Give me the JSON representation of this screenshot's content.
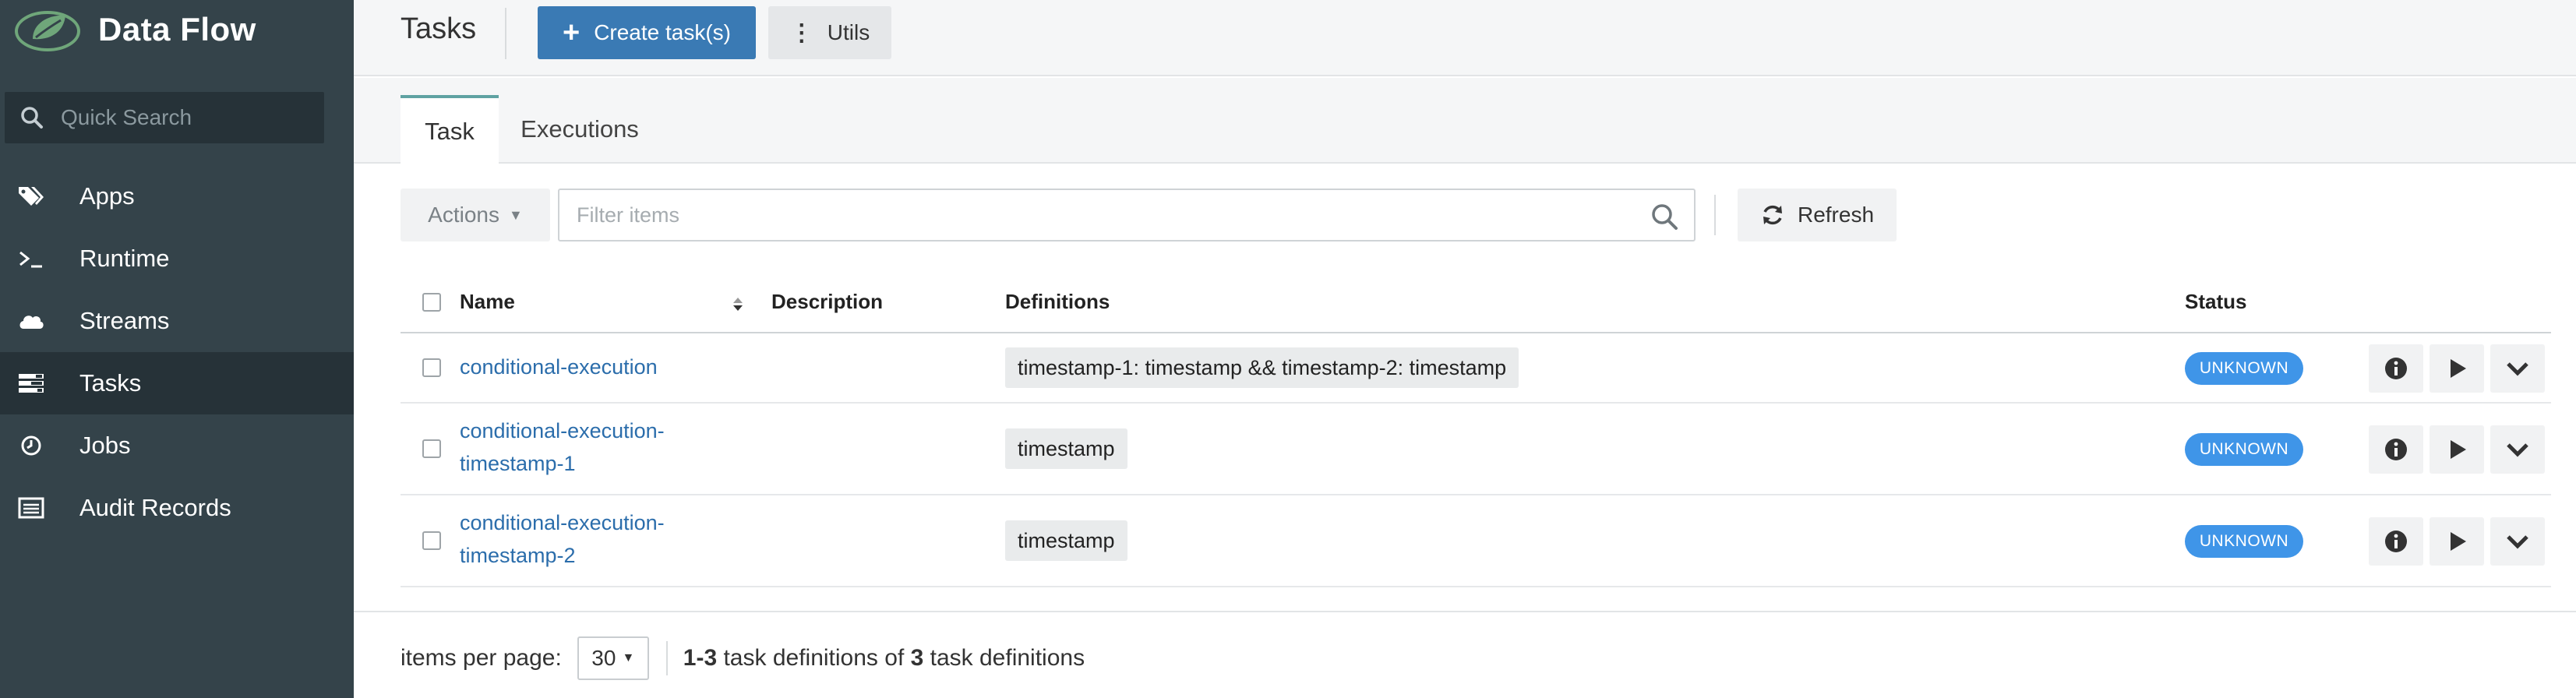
{
  "brand": {
    "title": "Data Flow"
  },
  "sidebar": {
    "search_placeholder": "Quick Search",
    "items": [
      {
        "label": "Apps",
        "icon": "tags-icon"
      },
      {
        "label": "Runtime",
        "icon": "terminal-icon"
      },
      {
        "label": "Streams",
        "icon": "cloud-icon"
      },
      {
        "label": "Tasks",
        "icon": "tasks-icon",
        "active": true
      },
      {
        "label": "Jobs",
        "icon": "clock-icon"
      },
      {
        "label": "Audit Records",
        "icon": "list-icon"
      }
    ]
  },
  "header": {
    "title": "Tasks",
    "create_label": "Create task(s)",
    "utils_label": "Utils"
  },
  "tabs": [
    {
      "label": "Task",
      "active": true
    },
    {
      "label": "Executions"
    }
  ],
  "toolbar": {
    "actions_label": "Actions",
    "filter_placeholder": "Filter items",
    "refresh_label": "Refresh"
  },
  "table": {
    "columns": {
      "name": "Name",
      "description": "Description",
      "definitions": "Definitions",
      "status": "Status"
    },
    "rows": [
      {
        "name_line1": "conditional-execution",
        "name_line2": "",
        "definition": "timestamp-1: timestamp && timestamp-2: timestamp",
        "status": "UNKNOWN"
      },
      {
        "name_line1": "conditional-execution-",
        "name_line2": "timestamp-1",
        "definition": "timestamp",
        "status": "UNKNOWN"
      },
      {
        "name_line1": "conditional-execution-",
        "name_line2": "timestamp-2",
        "definition": "timestamp",
        "status": "UNKNOWN"
      }
    ]
  },
  "footer": {
    "items_per_page_label": "items per page:",
    "items_per_page_value": "30",
    "range": "1-3",
    "middle_text": " task definitions of ",
    "total": "3",
    "end_text": " task definitions"
  },
  "colors": {
    "sidebar_bg": "#34434a",
    "primary": "#3a7ab4",
    "status_badge": "#3f95e8",
    "link": "#2b6dab"
  }
}
